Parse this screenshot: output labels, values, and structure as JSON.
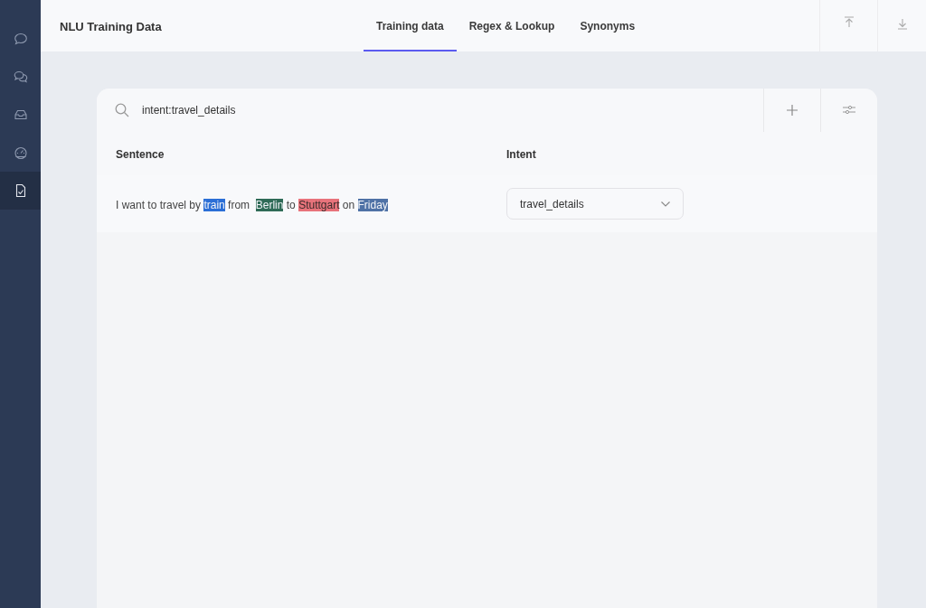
{
  "sidebar": {
    "items": [
      {
        "kind": "chat",
        "selected": false
      },
      {
        "kind": "chats",
        "selected": false
      },
      {
        "kind": "inbox",
        "selected": false
      },
      {
        "kind": "gauge",
        "selected": false
      },
      {
        "kind": "document",
        "selected": true
      }
    ]
  },
  "header": {
    "title": "NLU Training Data",
    "tabs": [
      {
        "label": "Training data",
        "selected": true
      },
      {
        "label": "Regex & Lookup",
        "selected": false
      },
      {
        "label": "Synonyms",
        "selected": false
      }
    ],
    "actions": [
      {
        "kind": "upload"
      },
      {
        "kind": "download"
      }
    ]
  },
  "search": {
    "value": "intent:travel_details"
  },
  "table": {
    "columns": [
      "Sentence",
      "Intent"
    ],
    "rows": [
      {
        "sentence": [
          {
            "text": "I want to travel by "
          },
          {
            "text": "train",
            "color": "#2b6fd6"
          },
          {
            "text": " from  "
          },
          {
            "text": "Berlin",
            "color": "#2f6b57"
          },
          {
            "text": " to "
          },
          {
            "text": "Stuttgart",
            "color": "#e8737b"
          },
          {
            "text": " on "
          },
          {
            "text": "Friday",
            "color": "#4f72a6"
          }
        ],
        "intent": "travel_details"
      }
    ]
  }
}
